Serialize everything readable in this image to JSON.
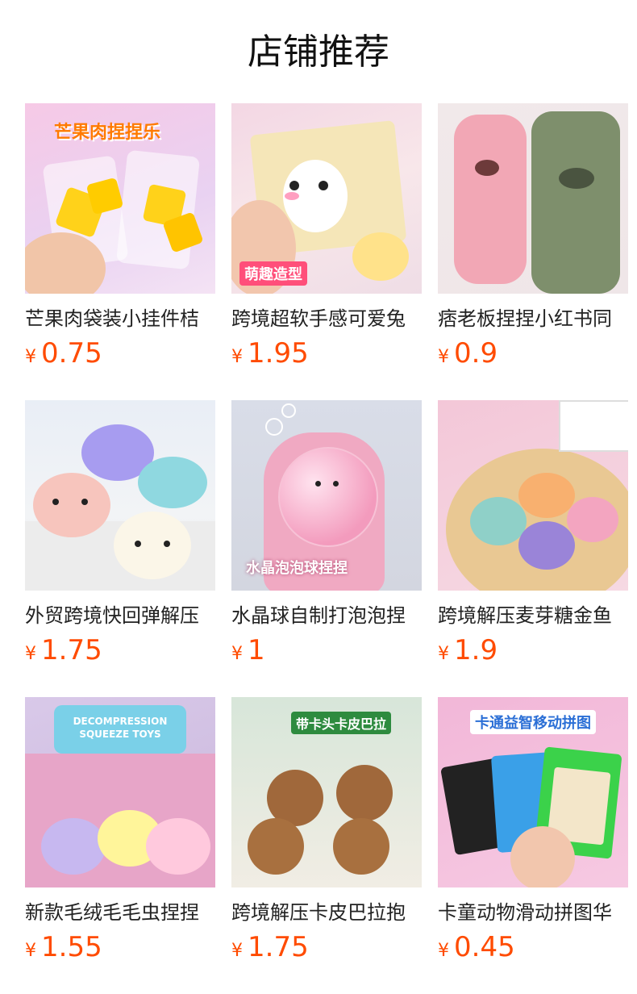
{
  "page": {
    "title": "店铺推荐"
  },
  "currency_symbol": "¥",
  "colors": {
    "price": "#ff4b00",
    "text": "#222222"
  },
  "products": [
    {
      "name": "芒果肉袋装小挂件桔",
      "price": "0.75",
      "image_text": "芒果肉捏捏乐",
      "icon": "mango-squishy-image"
    },
    {
      "name": "跨境超软手感可爱兔",
      "price": "1.95",
      "image_text": "萌趣造型",
      "icon": "bunny-squishy-image"
    },
    {
      "name": "痞老板捏捏小红书同",
      "price": "0.9",
      "image_text": "",
      "icon": "pickle-squishy-image"
    },
    {
      "name": "外贸跨境快回弹解压",
      "price": "1.75",
      "image_text": "",
      "icon": "axolotl-squishy-image"
    },
    {
      "name": "水晶球自制打泡泡捏",
      "price": "1",
      "image_text": "水晶泡泡球捏捏",
      "icon": "crystal-ball-image"
    },
    {
      "name": "跨境解压麦芽糖金鱼",
      "price": "1.9",
      "image_text": "",
      "icon": "goldfish-squishy-image"
    },
    {
      "name": "新款毛绒毛毛虫捏捏",
      "price": "1.55",
      "image_text": "DECOMPRESSION SQUEEZE TOYS",
      "icon": "caterpillar-squishy-image"
    },
    {
      "name": "跨境解压卡皮巴拉抱",
      "price": "1.75",
      "image_text": "带卡头卡皮巴拉",
      "icon": "capybara-squishy-image"
    },
    {
      "name": "卡童动物滑动拼图华",
      "price": "0.45",
      "image_text": "卡通益智移动拼图",
      "icon": "slide-puzzle-image"
    }
  ]
}
